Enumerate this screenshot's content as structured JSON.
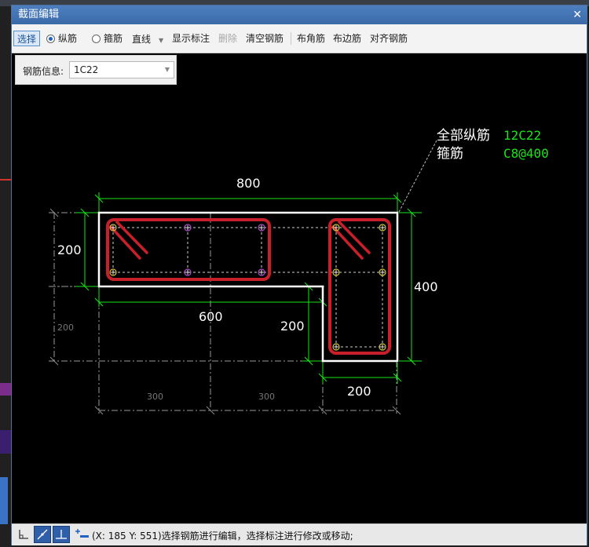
{
  "dialog": {
    "title": "截面编辑",
    "close": "✕"
  },
  "toolbar": {
    "select": "选择",
    "longitudinal": "纵筋",
    "stirrup": "箍筋",
    "line_type": "直线",
    "show_dims": "显示标注",
    "delete": "删除",
    "clear_rebar": "清空钢筋",
    "corner_rebar": "布角筋",
    "side_rebar": "布边筋",
    "align_rebar": "对齐钢筋"
  },
  "rebar_info": {
    "label": "钢筋信息:",
    "value": "1C22"
  },
  "annotation": {
    "all_long_label": "全部纵筋",
    "all_long_value": "12C22",
    "stirrup_label": "箍筋",
    "stirrup_value": "C8@400"
  },
  "dimensions": {
    "top_800": "800",
    "left_200": "200",
    "mid_600": "600",
    "inner_200": "200",
    "right_400": "400",
    "bottom_200": "200",
    "grid_left_200": "200",
    "grid_300_a": "300",
    "grid_300_b": "300"
  },
  "status": {
    "text": "(X: 185 Y: 551)选择钢筋进行编辑，选择标注进行修改或移动;"
  },
  "colors": {
    "section_outline": "#ffffff",
    "stirrup": "#c8202a",
    "dimension": "#19e619",
    "rebar_value": "#19e619",
    "axis": "#9a9a9a"
  }
}
